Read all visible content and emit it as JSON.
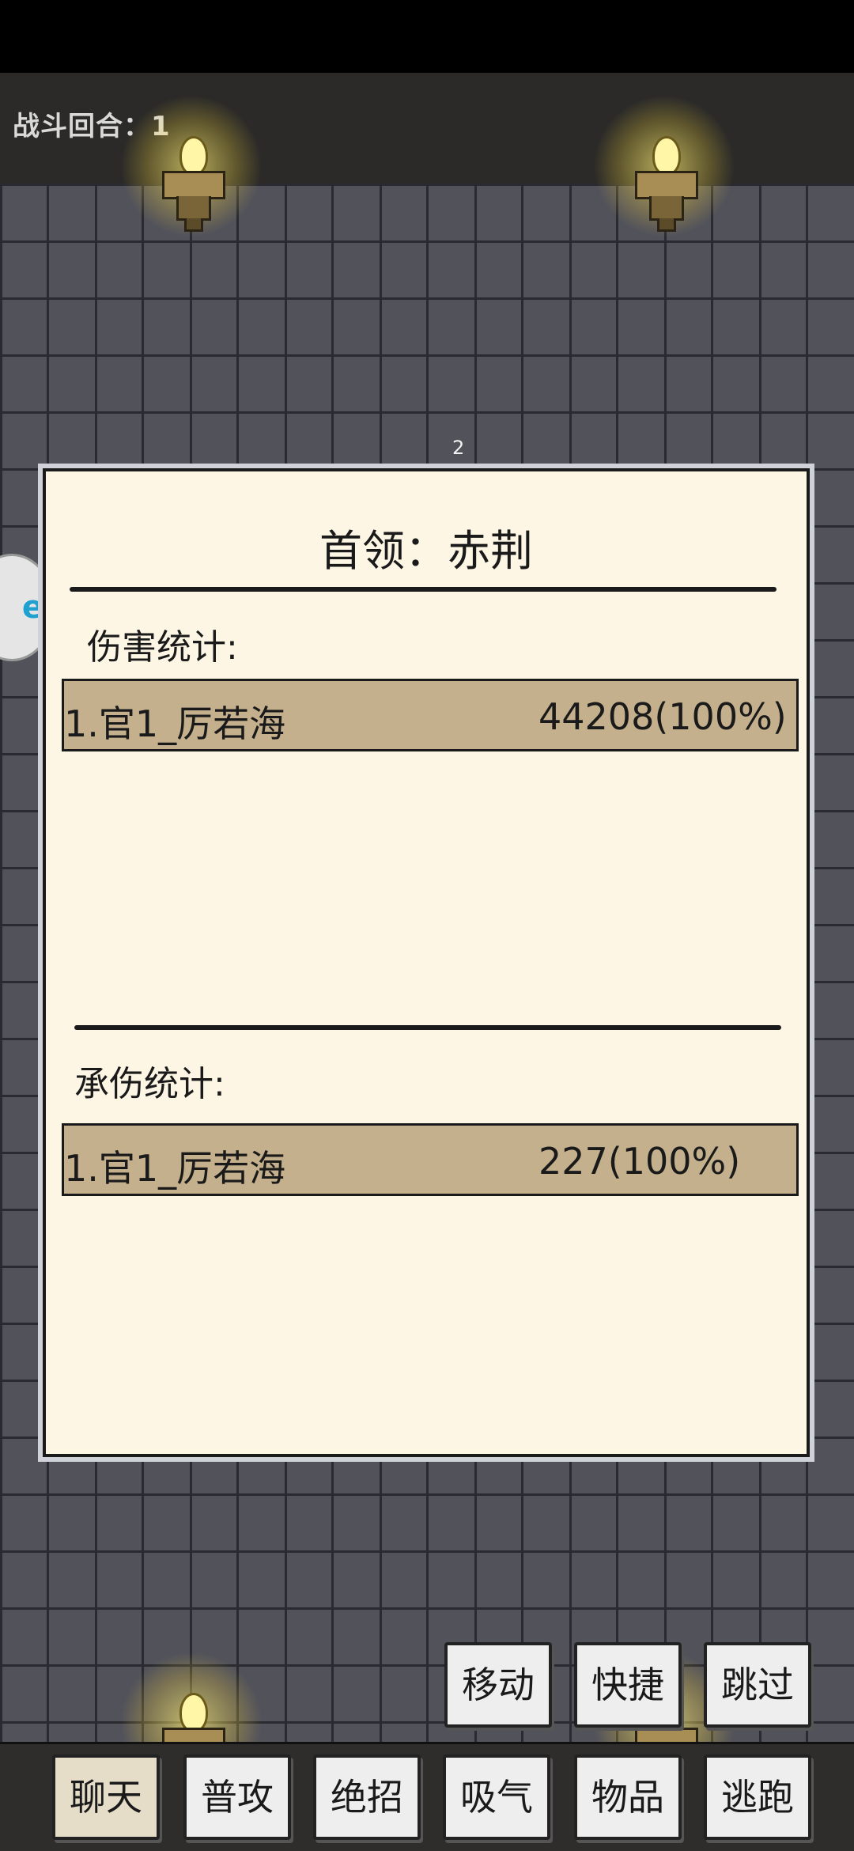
{
  "top_bar": {
    "round_text": "战斗回合：1"
  },
  "panel": {
    "index": "2",
    "title": "首领：赤荆",
    "damage_section": {
      "label": "伤害统计:",
      "rows": [
        {
          "name": "1.官1_厉若海",
          "value": "44208(100%)"
        }
      ]
    },
    "taken_section": {
      "label": "承伤统计:",
      "rows": [
        {
          "name": "1.官1_厉若海",
          "value": "227(100%)"
        }
      ]
    }
  },
  "actions_top": {
    "move": "移动",
    "shortcut": "快捷",
    "skip": "跳过"
  },
  "actions_bottom": {
    "chat": "聊天",
    "normal_attack": "普攻",
    "ultimate": "绝招",
    "breathe": "吸气",
    "items": "物品",
    "flee": "逃跑"
  },
  "side_badge": {
    "text": "e"
  },
  "colors": {
    "panel_bg": "#fdf6e4",
    "row_bg": "#c4b08d",
    "wall": "#52525a",
    "topbar": "#2b2a28"
  }
}
